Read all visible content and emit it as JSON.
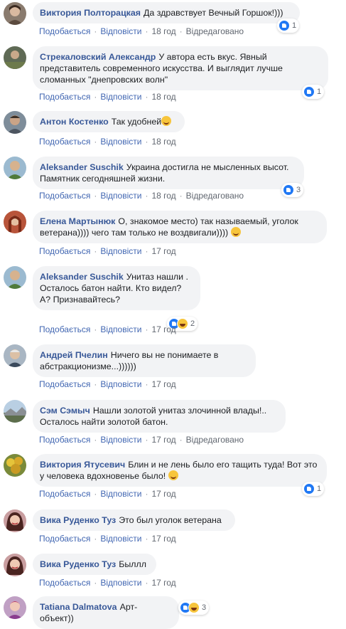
{
  "meta_labels": {
    "like": "Подобається",
    "reply": "Відповісти",
    "edited": "Відредаговано"
  },
  "comments": [
    {
      "author": "Виктория Полторацкая",
      "text": "Да здравствует Вечный Горшок!)))",
      "time": "18 год",
      "edited": true,
      "reactions": {
        "types": [
          "like"
        ],
        "count": "1"
      }
    },
    {
      "author": "Стрекаловский Александр",
      "text": "У автора есть вкус. Явный представитель современного искусства. И выглядит лучше сломанных \"днепровских волн\"",
      "time": "18 год",
      "edited": false,
      "reactions": {
        "types": [
          "like"
        ],
        "count": "1"
      }
    },
    {
      "author": "Антон Костенко",
      "text": "Так удобней",
      "emoji": "smile-emoji",
      "time": "18 год",
      "edited": false
    },
    {
      "author": "Aleksander Suschik",
      "text": "Украина достигла не мысленных высот. Памятник сегодняшней жизни.",
      "time": "18 год",
      "edited": true,
      "reactions": {
        "types": [
          "like"
        ],
        "count": "3"
      }
    },
    {
      "author": "Елена Мартынюк",
      "text": "О, знакомое место) так называемый, уголок ветерана)))) чего там только не воздвигали))))",
      "emoji": "laughing-emoji",
      "time": "17 год",
      "edited": false
    },
    {
      "author": "Aleksander Suschik",
      "text": "Унитаз нашли . Осталось батон найти. Кто видел? А? Признавайтесь?",
      "time": "17 год",
      "edited": false,
      "reactions": {
        "types": [
          "like",
          "haha"
        ],
        "count": "2"
      }
    },
    {
      "author": "Андрей Пчелин",
      "text": "Ничего вы не понимаете в абстракционизме...))))))",
      "time": "17 год",
      "edited": false
    },
    {
      "author": "Сэм Сэмыч",
      "text": "Нашли золотой унитаз злочинной влады!.. Осталось найти золотой батон.",
      "time": "17 год",
      "edited": true
    },
    {
      "author": "Виктория Ятусевич",
      "text": "Блин и не лень было его тащить туда! Вот это у человека вдохновенье было!",
      "emoji": "smile-emoji",
      "time": "17 год",
      "edited": false,
      "reactions": {
        "types": [
          "like"
        ],
        "count": "1"
      }
    },
    {
      "author": "Вика Руденко Туз",
      "text": "Это был уголок ветерана",
      "time": "17 год",
      "edited": false
    },
    {
      "author": "Вика Руденко Туз",
      "text": "Быллл",
      "time": "17 год",
      "edited": false
    },
    {
      "author": "Tatiana Dalmatova",
      "text": "Арт-объект))",
      "time": "",
      "edited": false,
      "reactions": {
        "types": [
          "like",
          "haha"
        ],
        "count": "3"
      }
    }
  ],
  "colors": {
    "author": "#385898",
    "link": "#4267b2",
    "bubble": "#f2f3f5",
    "meta": "#616770",
    "like": "#2078f4",
    "haha": "#f7c53c"
  }
}
